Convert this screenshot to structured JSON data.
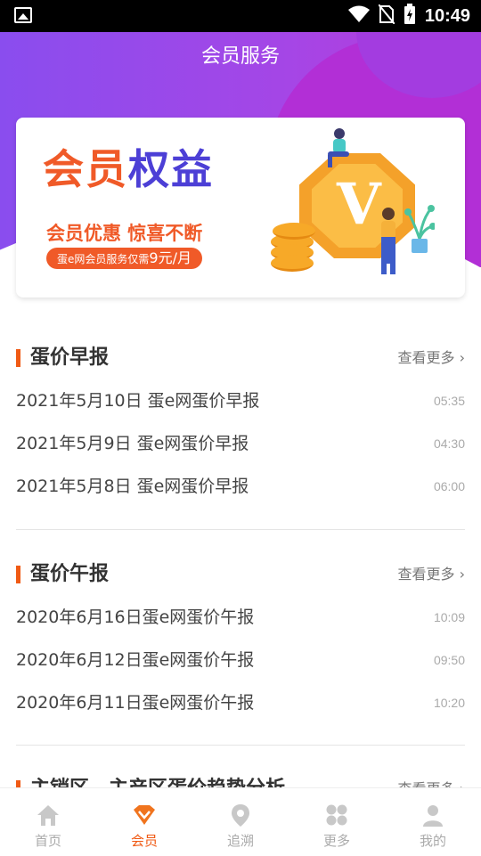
{
  "status_bar": {
    "time": "10:49"
  },
  "header": {
    "title": "会员服务"
  },
  "banner": {
    "title_part1": "会员",
    "title_part2": "权益",
    "subtitle": "会员优惠 惊喜不断",
    "price_prefix": "蛋e网会员服务仅需",
    "price_value": "9元/月",
    "badge_letter": "V"
  },
  "sections": [
    {
      "name": "蛋价早报",
      "more": "查看更多",
      "items": [
        {
          "title": "2021年5月10日 蛋e网蛋价早报",
          "time": "05:35"
        },
        {
          "title": "2021年5月9日 蛋e网蛋价早报",
          "time": "04:30"
        },
        {
          "title": "2021年5月8日 蛋e网蛋价早报",
          "time": "06:00"
        }
      ]
    },
    {
      "name": "蛋价午报",
      "more": "查看更多",
      "items": [
        {
          "title": "2020年6月16日蛋e网蛋价午报",
          "time": "10:09"
        },
        {
          "title": "2020年6月12日蛋e网蛋价午报",
          "time": "09:50"
        },
        {
          "title": "2020年6月11日蛋e网蛋价午报",
          "time": "10:20"
        }
      ]
    },
    {
      "name": "主销区、主产区蛋价趋势分析",
      "more": "查看更多"
    }
  ],
  "tabbar": {
    "tabs": [
      {
        "label": "首页",
        "icon": "home-icon"
      },
      {
        "label": "会员",
        "icon": "vip-icon",
        "active": true
      },
      {
        "label": "追溯",
        "icon": "location-icon"
      },
      {
        "label": "更多",
        "icon": "grid-icon"
      },
      {
        "label": "我的",
        "icon": "user-icon"
      }
    ]
  },
  "colors": {
    "accent": "#f05a14",
    "header": "#9b47e8"
  }
}
